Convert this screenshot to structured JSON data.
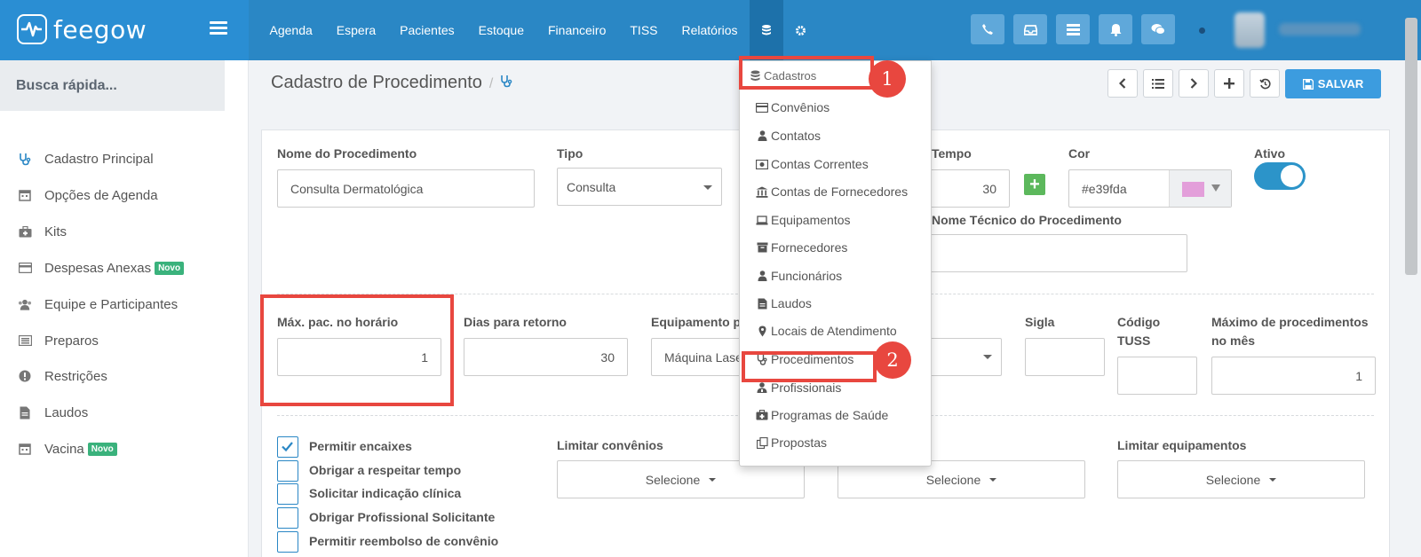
{
  "app": {
    "logo_text": "feegow"
  },
  "nav": {
    "items": [
      "Agenda",
      "Espera",
      "Pacientes",
      "Estoque",
      "Financeiro",
      "TISS",
      "Relatórios"
    ]
  },
  "sidebar": {
    "search_label": "Busca rápida...",
    "items": [
      {
        "label": "Cadastro Principal",
        "icon": "stethoscope-icon"
      },
      {
        "label": "Opções de Agenda",
        "icon": "calendar-icon"
      },
      {
        "label": "Kits",
        "icon": "medkit-icon"
      },
      {
        "label": "Despesas Anexas",
        "icon": "credit-card-icon",
        "badge": "Novo"
      },
      {
        "label": "Equipe e Participantes",
        "icon": "users-icon"
      },
      {
        "label": "Preparos",
        "icon": "list-icon"
      },
      {
        "label": "Restrições",
        "icon": "exclamation-icon"
      },
      {
        "label": "Laudos",
        "icon": "file-icon"
      },
      {
        "label": "Vacina",
        "icon": "calendar-icon",
        "badge": "Novo"
      }
    ]
  },
  "page": {
    "title": "Cadastro de Procedimento",
    "save_label": "SALVAR"
  },
  "form": {
    "nome_label": "Nome do Procedimento",
    "nome_value": "Consulta Dermatológica",
    "tipo_label": "Tipo",
    "tipo_value": "Consulta",
    "tempo_label": "Tempo",
    "tempo_value": "30",
    "cor_label": "Cor",
    "cor_value": "#e39fda",
    "ativo_label": "Ativo",
    "nome_tecnico_label": "Nome Técnico do Procedimento",
    "max_pac_label": "Máx. pac. no horário",
    "max_pac_value": "1",
    "dias_retorno_label": "Dias para retorno",
    "dias_retorno_value": "30",
    "equipamento_label": "Equipamento p",
    "equipamento_value": "Máquina Lase",
    "sigla_label": "Sigla",
    "codigo_tuss_label_1": "Código",
    "codigo_tuss_label_2": "TUSS",
    "max_proc_label_1": "Máximo de procedimentos",
    "max_proc_label_2": "no mês",
    "max_proc_value": "1",
    "checkboxes": [
      {
        "label": "Permitir encaixes",
        "checked": true
      },
      {
        "label": "Obrigar a respeitar tempo",
        "checked": false
      },
      {
        "label": "Solicitar indicação clínica",
        "checked": false
      },
      {
        "label": "Obrigar Profissional Solicitante",
        "checked": false
      },
      {
        "label": "Permitir reembolso de convênio",
        "checked": false
      }
    ],
    "limitar_convenios_label": "Limitar convênios",
    "limitar_equipamentos_label": "Limitar equipamentos",
    "selecione": "Selecione"
  },
  "dropdown": {
    "header": "Cadastros",
    "items": [
      "Convênios",
      "Contatos",
      "Contas Correntes",
      "Contas de Fornecedores",
      "Equipamentos",
      "Fornecedores",
      "Funcionários",
      "Laudos",
      "Locais de Atendimento",
      "Procedimentos",
      "Profissionais",
      "Programas de Saúde",
      "Propostas"
    ]
  },
  "annotations": {
    "step1": "1",
    "step2": "2"
  },
  "colors": {
    "topbar": "#2a87c5",
    "accent": "#3c9cdf",
    "highlight": "#e8473f",
    "badge": "#3ab27c"
  }
}
